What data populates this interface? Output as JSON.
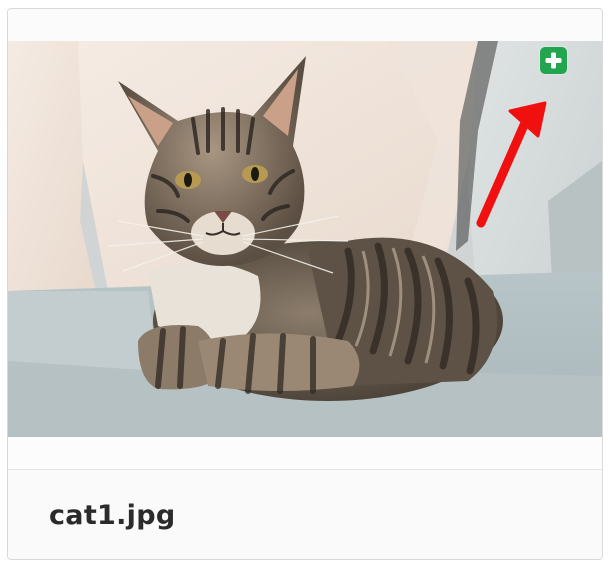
{
  "file": {
    "name": "cat1.jpg"
  },
  "actions": {
    "add_icon": "plus-icon",
    "accent_color": "#23a550",
    "annotation_color": "#f01010"
  }
}
